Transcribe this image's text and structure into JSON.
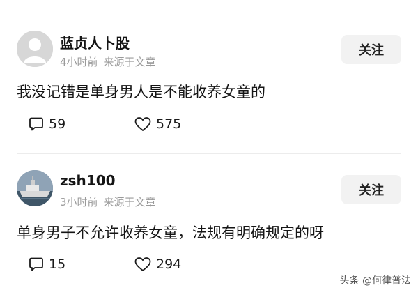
{
  "comments": [
    {
      "author": "蓝贞人卜股",
      "time": "4小时前",
      "source": "来源于文章",
      "follow_label": "关注",
      "text": "我没记错是单身男人是不能收养女童的",
      "reply_count": "59",
      "like_count": "575",
      "avatar": "default-avatar"
    },
    {
      "author": "zsh100",
      "time": "3小时前",
      "source": "来源于文章",
      "follow_label": "关注",
      "text": "单身男子不允许收养女童，法规有明确规定的呀",
      "reply_count": "15",
      "like_count": "294",
      "avatar": "photo-avatar"
    }
  ],
  "icons": {
    "reply": "comment-bubble-icon",
    "like": "heart-icon"
  },
  "watermark": "头条 @何律普法"
}
